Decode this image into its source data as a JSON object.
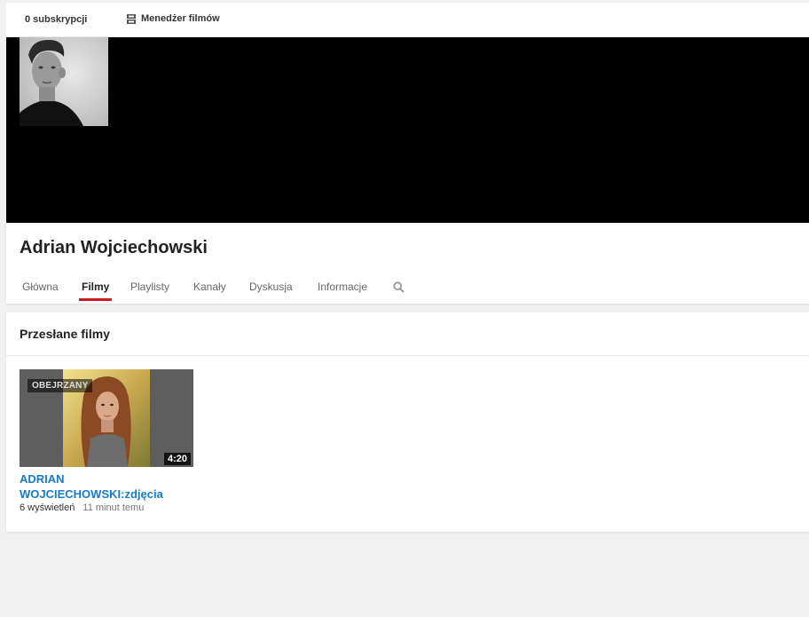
{
  "topbar": {
    "subscriptions_label": "0 subskrypcji",
    "video_manager_label": "Menedżer filmów",
    "video_manager_icon": "video-manager-icon"
  },
  "channel": {
    "name": "Adrian Wojciechowski",
    "banner_color": "#000000"
  },
  "tabs": [
    {
      "label": "Główna"
    },
    {
      "label": "Filmy",
      "active": true
    },
    {
      "label": "Playlisty"
    },
    {
      "label": "Kanały"
    },
    {
      "label": "Dyskusja"
    },
    {
      "label": "Informacje"
    }
  ],
  "search_icon": "search-icon",
  "section": {
    "title": "Przesłane filmy"
  },
  "videos": [
    {
      "title": "ADRIAN WOJCIECHOWSKI:zdjęcia",
      "badge": "OBEJRZANY",
      "duration": "4:20",
      "views": "6 wyświetleń",
      "age": "11 minut temu"
    }
  ],
  "colors": {
    "accent_red": "#cc181e",
    "link_blue": "#167ac6",
    "page_bg": "#f1f1f1"
  }
}
